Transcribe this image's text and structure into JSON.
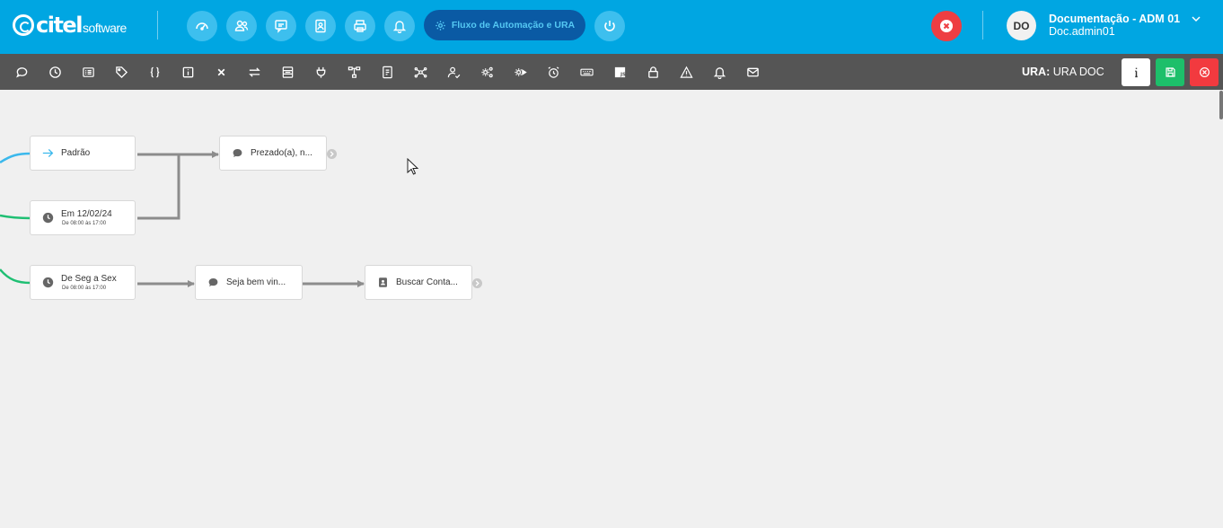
{
  "header": {
    "logo_text": "citel",
    "logo_sub": "software",
    "nav_icons": [
      "dashboard-icon",
      "users-icon",
      "chat-icon",
      "contact-card-icon",
      "printer-icon",
      "bell-icon"
    ],
    "active_module": "Fluxo de Automação e URA",
    "power_icon": "power-icon",
    "user": {
      "initials": "DO",
      "name": "Documentação - ADM 01",
      "login": "Doc.admin01"
    },
    "colors": {
      "bar": "#00a6e2",
      "nav_button": "#3dbfee",
      "active_pill": "#0a5aa4",
      "alert": "#ee3e42"
    }
  },
  "toolbar": {
    "tools": [
      "message-icon",
      "clock-icon",
      "form-icon",
      "tag-icon",
      "braces-icon",
      "info-box-icon",
      "close-icon",
      "transfer-icon",
      "queue-icon",
      "plug-icon",
      "tree-icon",
      "document-icon",
      "network-icon",
      "user-check-icon",
      "settings-gear-icon",
      "gear-play-icon",
      "alarm-icon",
      "keyboard-icon",
      "js-icon",
      "lock-icon",
      "warning-icon",
      "bell-icon",
      "mail-icon"
    ],
    "ura_key": "URA:",
    "ura_value": "URA DOC",
    "buttons": [
      {
        "icon": "info-icon",
        "color": "#ffffff"
      },
      {
        "icon": "save-icon",
        "color": "#1dbf6a"
      },
      {
        "icon": "cancel-icon",
        "color": "#f23a3f"
      }
    ]
  },
  "flow": {
    "nodes": [
      {
        "id": "padrao",
        "icon": "arrow-right-icon",
        "label": "Padrão",
        "sub": ""
      },
      {
        "id": "em1202",
        "icon": "clock-icon",
        "label": "Em 12/02/24",
        "sub": "De 08:00 às 17:00"
      },
      {
        "id": "segsex",
        "icon": "clock-icon",
        "label": "De Seg a Sex",
        "sub": "De 08:00 às 17:00"
      },
      {
        "id": "prezado",
        "icon": "message-icon",
        "label": "Prezado(a), n...",
        "sub": ""
      },
      {
        "id": "seja",
        "icon": "message-icon",
        "label": "Seja bem vin...",
        "sub": ""
      },
      {
        "id": "buscar",
        "icon": "contact-icon",
        "label": "Buscar Conta...",
        "sub": ""
      }
    ],
    "edges": [
      [
        "padrao",
        "prezado"
      ],
      [
        "em1202",
        "prezado"
      ],
      [
        "segsex",
        "seja"
      ],
      [
        "seja",
        "buscar"
      ]
    ],
    "colors": {
      "edge": "#8c8c8c",
      "incoming_blue": "#3bb8ec",
      "incoming_green": "#1fbf73"
    }
  }
}
